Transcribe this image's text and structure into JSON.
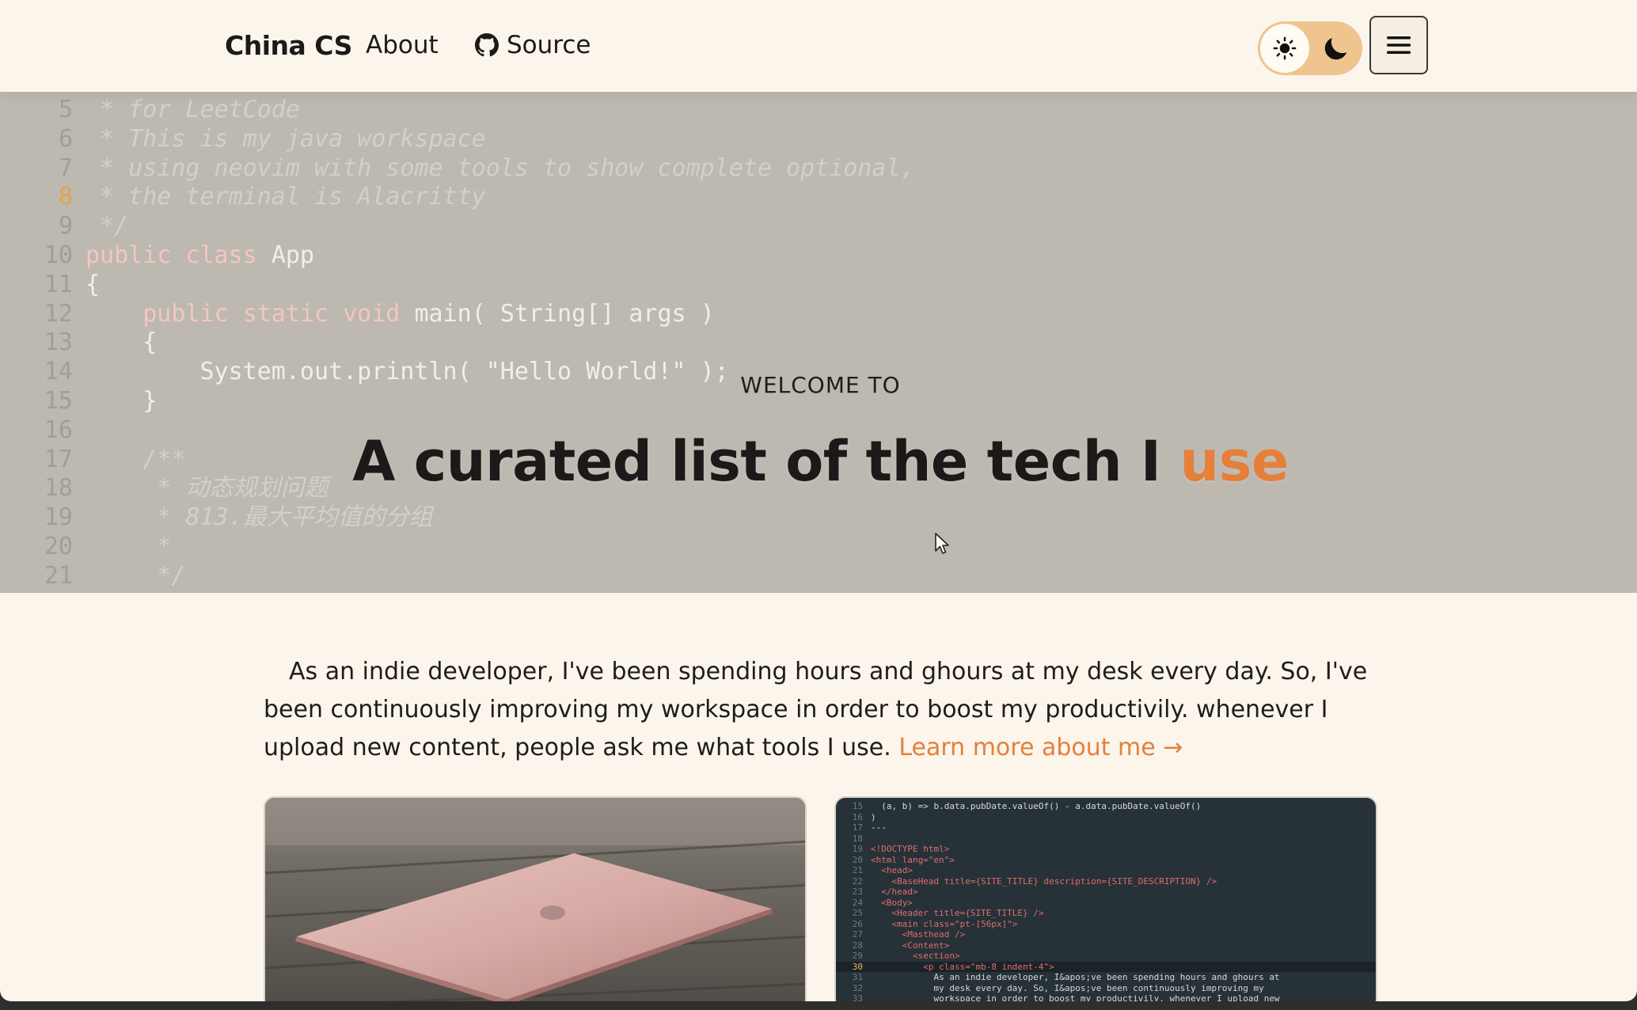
{
  "header": {
    "brand": "China CS",
    "nav": {
      "about": "About",
      "source": "Source"
    },
    "theme_toggle": {
      "light_icon": "sun-icon",
      "dark_icon": "moon-icon",
      "active": "light"
    },
    "menu_icon": "hamburger-menu-icon"
  },
  "hero": {
    "code_lines": [
      {
        "n": "5",
        "text": " * for LeetCode"
      },
      {
        "n": "6",
        "text": " * This is my java workspace"
      },
      {
        "n": "7",
        "text": " * using neovim with some tools to show complete optional,"
      },
      {
        "n": "8",
        "text": " * the terminal is Alacritty"
      },
      {
        "n": "9",
        "text": " */"
      },
      {
        "n": "10",
        "text": "public class App"
      },
      {
        "n": "11",
        "text": "{"
      },
      {
        "n": "12",
        "text": "    public static void main( String[] args )"
      },
      {
        "n": "13",
        "text": "    {"
      },
      {
        "n": "14",
        "text": "        System.out.println( \"Hello World!\" );"
      },
      {
        "n": "15",
        "text": "    }"
      },
      {
        "n": "16",
        "text": ""
      },
      {
        "n": "17",
        "text": "    /**"
      },
      {
        "n": "18",
        "text": "     * 动态规划问题"
      },
      {
        "n": "19",
        "text": "     * 813.最大平均值的分组"
      },
      {
        "n": "20",
        "text": "     *"
      },
      {
        "n": "21",
        "text": "     */"
      }
    ],
    "welcome": "WELCOME TO",
    "title_main": "A curated list of the tech I ",
    "title_accent": "use"
  },
  "intro": {
    "text": "As an indie developer, I've been spending hours and ghours at my desk every day. So, I've been continuously improving my workspace in order to boost my productivily. whenever I upload new content, people ask me what tools I use. ",
    "link": "Learn more about me →"
  },
  "cards": {
    "card1_image": "laptop-photo",
    "card2_code": [
      {
        "n": "15",
        "text": "  (a, b) => b.data.pubDate.valueOf() - a.data.pubDate.valueOf()"
      },
      {
        "n": "16",
        "text": ")"
      },
      {
        "n": "17",
        "text": "---"
      },
      {
        "n": "18",
        "text": ""
      },
      {
        "n": "19",
        "text": "<!DOCTYPE html>"
      },
      {
        "n": "20",
        "text": "<html lang=\"en\">"
      },
      {
        "n": "21",
        "text": "  <head>"
      },
      {
        "n": "22",
        "text": "    <BaseHead title={SITE_TITLE} description={SITE_DESCRIPTION} />"
      },
      {
        "n": "23",
        "text": "  </head>"
      },
      {
        "n": "24",
        "text": "  <Body>"
      },
      {
        "n": "25",
        "text": "    <Header title={SITE_TITLE} />"
      },
      {
        "n": "26",
        "text": "    <main class=\"pt-[56px]\">"
      },
      {
        "n": "27",
        "text": "      <Masthead />"
      },
      {
        "n": "28",
        "text": "      <Content>"
      },
      {
        "n": "29",
        "text": "        <section>"
      },
      {
        "n": "30",
        "text": "          <p class=\"mb-8 indent-4\">"
      },
      {
        "n": "31",
        "text": "            As an indie developer, I&apos;ve been spending hours and ghours at"
      },
      {
        "n": "32",
        "text": "            my desk every day. So, I&apos;ve been continuously improving my"
      },
      {
        "n": "33",
        "text": "            workspace in order to boost my productivily. whenever I upload new"
      }
    ]
  },
  "colors": {
    "accent": "#e5803a",
    "background": "#fbf5ec",
    "toggle": "#efc48e"
  }
}
